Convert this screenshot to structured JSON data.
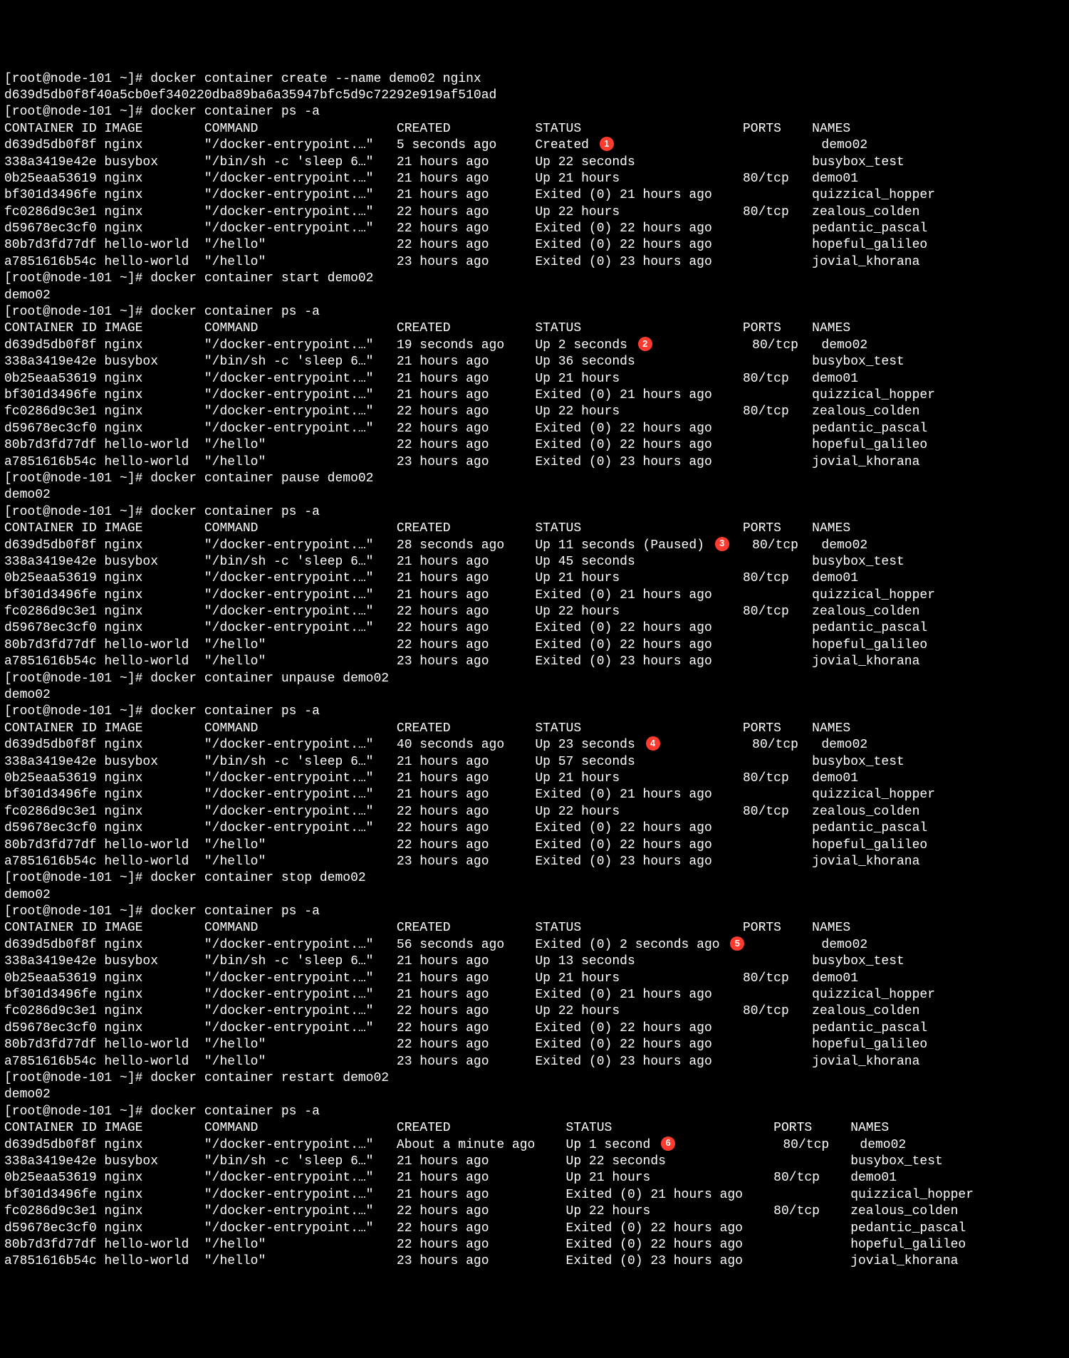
{
  "prompt_prefix": "[root@node-101 ~]# ",
  "commands": {
    "create": "docker container create --name demo02 nginx",
    "create_output": "d639d5db0f8f40a5cb0ef340220dba89ba6a35947bfc5d9c72292e919af510ad",
    "ps": "docker container ps -a",
    "start": "docker container start demo02",
    "start_output": "demo02",
    "pause": "docker container pause demo02",
    "pause_output": "demo02",
    "unpause": "docker container unpause demo02",
    "unpause_output": "demo02",
    "stop": "docker container stop demo02",
    "stop_output": "demo02",
    "restart": "docker container restart demo02",
    "restart_output": "demo02"
  },
  "headers": {
    "id": "CONTAINER ID",
    "image": "IMAGE",
    "command": "COMMAND",
    "created": "CREATED",
    "status": "STATUS",
    "ports": "PORTS",
    "names": "NAMES"
  },
  "tables": [
    {
      "badge": "1",
      "rows": [
        {
          "id": "d639d5db0f8f",
          "image": "nginx",
          "command": "\"/docker-entrypoint.…\"",
          "created": "5 seconds ago",
          "status": "Created",
          "ports": "",
          "names": "demo02"
        },
        {
          "id": "338a3419e42e",
          "image": "busybox",
          "command": "\"/bin/sh -c 'sleep 6…\"",
          "created": "21 hours ago",
          "status": "Up 22 seconds",
          "ports": "",
          "names": "busybox_test"
        },
        {
          "id": "0b25eaa53619",
          "image": "nginx",
          "command": "\"/docker-entrypoint.…\"",
          "created": "21 hours ago",
          "status": "Up 21 hours",
          "ports": "80/tcp",
          "names": "demo01"
        },
        {
          "id": "bf301d3496fe",
          "image": "nginx",
          "command": "\"/docker-entrypoint.…\"",
          "created": "21 hours ago",
          "status": "Exited (0) 21 hours ago",
          "ports": "",
          "names": "quizzical_hopper"
        },
        {
          "id": "fc0286d9c3e1",
          "image": "nginx",
          "command": "\"/docker-entrypoint.…\"",
          "created": "22 hours ago",
          "status": "Up 22 hours",
          "ports": "80/tcp",
          "names": "zealous_colden"
        },
        {
          "id": "d59678ec3cf0",
          "image": "nginx",
          "command": "\"/docker-entrypoint.…\"",
          "created": "22 hours ago",
          "status": "Exited (0) 22 hours ago",
          "ports": "",
          "names": "pedantic_pascal"
        },
        {
          "id": "80b7d3fd77df",
          "image": "hello-world",
          "command": "\"/hello\"",
          "created": "22 hours ago",
          "status": "Exited (0) 22 hours ago",
          "ports": "",
          "names": "hopeful_galileo"
        },
        {
          "id": "a7851616b54c",
          "image": "hello-world",
          "command": "\"/hello\"",
          "created": "23 hours ago",
          "status": "Exited (0) 23 hours ago",
          "ports": "",
          "names": "jovial_khorana"
        }
      ]
    },
    {
      "badge": "2",
      "rows": [
        {
          "id": "d639d5db0f8f",
          "image": "nginx",
          "command": "\"/docker-entrypoint.…\"",
          "created": "19 seconds ago",
          "status": "Up 2 seconds",
          "ports": "80/tcp",
          "names": "demo02"
        },
        {
          "id": "338a3419e42e",
          "image": "busybox",
          "command": "\"/bin/sh -c 'sleep 6…\"",
          "created": "21 hours ago",
          "status": "Up 36 seconds",
          "ports": "",
          "names": "busybox_test"
        },
        {
          "id": "0b25eaa53619",
          "image": "nginx",
          "command": "\"/docker-entrypoint.…\"",
          "created": "21 hours ago",
          "status": "Up 21 hours",
          "ports": "80/tcp",
          "names": "demo01"
        },
        {
          "id": "bf301d3496fe",
          "image": "nginx",
          "command": "\"/docker-entrypoint.…\"",
          "created": "21 hours ago",
          "status": "Exited (0) 21 hours ago",
          "ports": "",
          "names": "quizzical_hopper"
        },
        {
          "id": "fc0286d9c3e1",
          "image": "nginx",
          "command": "\"/docker-entrypoint.…\"",
          "created": "22 hours ago",
          "status": "Up 22 hours",
          "ports": "80/tcp",
          "names": "zealous_colden"
        },
        {
          "id": "d59678ec3cf0",
          "image": "nginx",
          "command": "\"/docker-entrypoint.…\"",
          "created": "22 hours ago",
          "status": "Exited (0) 22 hours ago",
          "ports": "",
          "names": "pedantic_pascal"
        },
        {
          "id": "80b7d3fd77df",
          "image": "hello-world",
          "command": "\"/hello\"",
          "created": "22 hours ago",
          "status": "Exited (0) 22 hours ago",
          "ports": "",
          "names": "hopeful_galileo"
        },
        {
          "id": "a7851616b54c",
          "image": "hello-world",
          "command": "\"/hello\"",
          "created": "23 hours ago",
          "status": "Exited (0) 23 hours ago",
          "ports": "",
          "names": "jovial_khorana"
        }
      ]
    },
    {
      "badge": "3",
      "rows": [
        {
          "id": "d639d5db0f8f",
          "image": "nginx",
          "command": "\"/docker-entrypoint.…\"",
          "created": "28 seconds ago",
          "status": "Up 11 seconds (Paused)",
          "ports": "80/tcp",
          "names": "demo02"
        },
        {
          "id": "338a3419e42e",
          "image": "busybox",
          "command": "\"/bin/sh -c 'sleep 6…\"",
          "created": "21 hours ago",
          "status": "Up 45 seconds",
          "ports": "",
          "names": "busybox_test"
        },
        {
          "id": "0b25eaa53619",
          "image": "nginx",
          "command": "\"/docker-entrypoint.…\"",
          "created": "21 hours ago",
          "status": "Up 21 hours",
          "ports": "80/tcp",
          "names": "demo01"
        },
        {
          "id": "bf301d3496fe",
          "image": "nginx",
          "command": "\"/docker-entrypoint.…\"",
          "created": "21 hours ago",
          "status": "Exited (0) 21 hours ago",
          "ports": "",
          "names": "quizzical_hopper"
        },
        {
          "id": "fc0286d9c3e1",
          "image": "nginx",
          "command": "\"/docker-entrypoint.…\"",
          "created": "22 hours ago",
          "status": "Up 22 hours",
          "ports": "80/tcp",
          "names": "zealous_colden"
        },
        {
          "id": "d59678ec3cf0",
          "image": "nginx",
          "command": "\"/docker-entrypoint.…\"",
          "created": "22 hours ago",
          "status": "Exited (0) 22 hours ago",
          "ports": "",
          "names": "pedantic_pascal"
        },
        {
          "id": "80b7d3fd77df",
          "image": "hello-world",
          "command": "\"/hello\"",
          "created": "22 hours ago",
          "status": "Exited (0) 22 hours ago",
          "ports": "",
          "names": "hopeful_galileo"
        },
        {
          "id": "a7851616b54c",
          "image": "hello-world",
          "command": "\"/hello\"",
          "created": "23 hours ago",
          "status": "Exited (0) 23 hours ago",
          "ports": "",
          "names": "jovial_khorana"
        }
      ]
    },
    {
      "badge": "4",
      "rows": [
        {
          "id": "d639d5db0f8f",
          "image": "nginx",
          "command": "\"/docker-entrypoint.…\"",
          "created": "40 seconds ago",
          "status": "Up 23 seconds",
          "ports": "80/tcp",
          "names": "demo02"
        },
        {
          "id": "338a3419e42e",
          "image": "busybox",
          "command": "\"/bin/sh -c 'sleep 6…\"",
          "created": "21 hours ago",
          "status": "Up 57 seconds",
          "ports": "",
          "names": "busybox_test"
        },
        {
          "id": "0b25eaa53619",
          "image": "nginx",
          "command": "\"/docker-entrypoint.…\"",
          "created": "21 hours ago",
          "status": "Up 21 hours",
          "ports": "80/tcp",
          "names": "demo01"
        },
        {
          "id": "bf301d3496fe",
          "image": "nginx",
          "command": "\"/docker-entrypoint.…\"",
          "created": "21 hours ago",
          "status": "Exited (0) 21 hours ago",
          "ports": "",
          "names": "quizzical_hopper"
        },
        {
          "id": "fc0286d9c3e1",
          "image": "nginx",
          "command": "\"/docker-entrypoint.…\"",
          "created": "22 hours ago",
          "status": "Up 22 hours",
          "ports": "80/tcp",
          "names": "zealous_colden"
        },
        {
          "id": "d59678ec3cf0",
          "image": "nginx",
          "command": "\"/docker-entrypoint.…\"",
          "created": "22 hours ago",
          "status": "Exited (0) 22 hours ago",
          "ports": "",
          "names": "pedantic_pascal"
        },
        {
          "id": "80b7d3fd77df",
          "image": "hello-world",
          "command": "\"/hello\"",
          "created": "22 hours ago",
          "status": "Exited (0) 22 hours ago",
          "ports": "",
          "names": "hopeful_galileo"
        },
        {
          "id": "a7851616b54c",
          "image": "hello-world",
          "command": "\"/hello\"",
          "created": "23 hours ago",
          "status": "Exited (0) 23 hours ago",
          "ports": "",
          "names": "jovial_khorana"
        }
      ]
    },
    {
      "badge": "5",
      "rows": [
        {
          "id": "d639d5db0f8f",
          "image": "nginx",
          "command": "\"/docker-entrypoint.…\"",
          "created": "56 seconds ago",
          "status": "Exited (0) 2 seconds ago",
          "ports": "",
          "names": "demo02"
        },
        {
          "id": "338a3419e42e",
          "image": "busybox",
          "command": "\"/bin/sh -c 'sleep 6…\"",
          "created": "21 hours ago",
          "status": "Up 13 seconds",
          "ports": "",
          "names": "busybox_test"
        },
        {
          "id": "0b25eaa53619",
          "image": "nginx",
          "command": "\"/docker-entrypoint.…\"",
          "created": "21 hours ago",
          "status": "Up 21 hours",
          "ports": "80/tcp",
          "names": "demo01"
        },
        {
          "id": "bf301d3496fe",
          "image": "nginx",
          "command": "\"/docker-entrypoint.…\"",
          "created": "21 hours ago",
          "status": "Exited (0) 21 hours ago",
          "ports": "",
          "names": "quizzical_hopper"
        },
        {
          "id": "fc0286d9c3e1",
          "image": "nginx",
          "command": "\"/docker-entrypoint.…\"",
          "created": "22 hours ago",
          "status": "Up 22 hours",
          "ports": "80/tcp",
          "names": "zealous_colden"
        },
        {
          "id": "d59678ec3cf0",
          "image": "nginx",
          "command": "\"/docker-entrypoint.…\"",
          "created": "22 hours ago",
          "status": "Exited (0) 22 hours ago",
          "ports": "",
          "names": "pedantic_pascal"
        },
        {
          "id": "80b7d3fd77df",
          "image": "hello-world",
          "command": "\"/hello\"",
          "created": "22 hours ago",
          "status": "Exited (0) 22 hours ago",
          "ports": "",
          "names": "hopeful_galileo"
        },
        {
          "id": "a7851616b54c",
          "image": "hello-world",
          "command": "\"/hello\"",
          "created": "23 hours ago",
          "status": "Exited (0) 23 hours ago",
          "ports": "",
          "names": "jovial_khorana"
        }
      ]
    },
    {
      "badge": "6",
      "col_widths": {
        "id": 13,
        "image": 13,
        "command": 25,
        "created": 22,
        "status": 27,
        "ports": 10
      },
      "rows": [
        {
          "id": "d639d5db0f8f",
          "image": "nginx",
          "command": "\"/docker-entrypoint.…\"",
          "created": "About a minute ago",
          "status": "Up 1 second",
          "ports": "80/tcp",
          "names": "demo02"
        },
        {
          "id": "338a3419e42e",
          "image": "busybox",
          "command": "\"/bin/sh -c 'sleep 6…\"",
          "created": "21 hours ago",
          "status": "Up 22 seconds",
          "ports": "",
          "names": "busybox_test"
        },
        {
          "id": "0b25eaa53619",
          "image": "nginx",
          "command": "\"/docker-entrypoint.…\"",
          "created": "21 hours ago",
          "status": "Up 21 hours",
          "ports": "80/tcp",
          "names": "demo01"
        },
        {
          "id": "bf301d3496fe",
          "image": "nginx",
          "command": "\"/docker-entrypoint.…\"",
          "created": "21 hours ago",
          "status": "Exited (0) 21 hours ago",
          "ports": "",
          "names": "quizzical_hopper"
        },
        {
          "id": "fc0286d9c3e1",
          "image": "nginx",
          "command": "\"/docker-entrypoint.…\"",
          "created": "22 hours ago",
          "status": "Up 22 hours",
          "ports": "80/tcp",
          "names": "zealous_colden"
        },
        {
          "id": "d59678ec3cf0",
          "image": "nginx",
          "command": "\"/docker-entrypoint.…\"",
          "created": "22 hours ago",
          "status": "Exited (0) 22 hours ago",
          "ports": "",
          "names": "pedantic_pascal"
        },
        {
          "id": "80b7d3fd77df",
          "image": "hello-world",
          "command": "\"/hello\"",
          "created": "22 hours ago",
          "status": "Exited (0) 22 hours ago",
          "ports": "",
          "names": "hopeful_galileo"
        },
        {
          "id": "a7851616b54c",
          "image": "hello-world",
          "command": "\"/hello\"",
          "created": "23 hours ago",
          "status": "Exited (0) 23 hours ago",
          "ports": "",
          "names": "jovial_khorana"
        }
      ]
    }
  ],
  "default_col_widths": {
    "id": 13,
    "image": 13,
    "command": 25,
    "created": 18,
    "status": 27,
    "ports": 9
  }
}
